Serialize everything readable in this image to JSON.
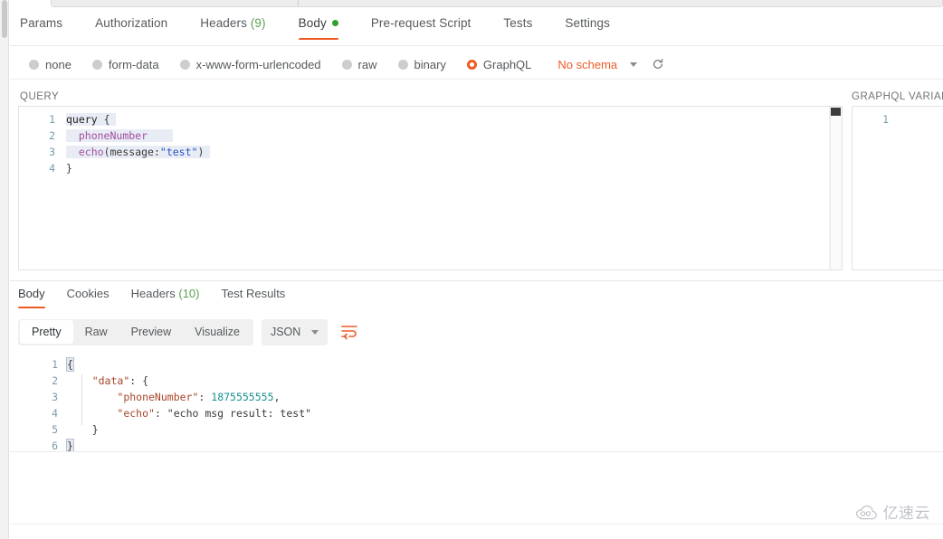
{
  "request_tabs": [
    {
      "label": "Params",
      "count": "",
      "active": false,
      "dot": false
    },
    {
      "label": "Authorization",
      "count": "",
      "active": false,
      "dot": false
    },
    {
      "label": "Headers",
      "count": "(9)",
      "active": false,
      "dot": false
    },
    {
      "label": "Body",
      "count": "",
      "active": true,
      "dot": true
    },
    {
      "label": "Pre-request Script",
      "count": "",
      "active": false,
      "dot": false
    },
    {
      "label": "Tests",
      "count": "",
      "active": false,
      "dot": false
    },
    {
      "label": "Settings",
      "count": "",
      "active": false,
      "dot": false
    }
  ],
  "body_types": [
    {
      "label": "none",
      "selected": false
    },
    {
      "label": "form-data",
      "selected": false
    },
    {
      "label": "x-www-form-urlencoded",
      "selected": false
    },
    {
      "label": "raw",
      "selected": false
    },
    {
      "label": "binary",
      "selected": false
    },
    {
      "label": "GraphQL",
      "selected": true
    }
  ],
  "schema": {
    "label": "No schema",
    "dropdown_icon": "chevron-down-icon",
    "refresh_icon": "refresh-icon",
    "accent_color": "#f05a28"
  },
  "query_panel": {
    "title": "QUERY",
    "line_numbers": [
      "1",
      "2",
      "3",
      "4"
    ],
    "lines": [
      {
        "text": "query {",
        "highlight": true
      },
      {
        "text": "  phoneNumber",
        "highlight": true
      },
      {
        "text": "  echo(message:\"test\")",
        "highlight": true
      },
      {
        "text": "}",
        "highlight": false
      }
    ],
    "code": "query {\n  phoneNumber\n  echo(message:\"test\")\n}"
  },
  "variables_panel": {
    "title": "GRAPHQL VARIABL",
    "line_numbers": [
      "1"
    ],
    "lines": [
      ""
    ]
  },
  "response_tabs": [
    {
      "label": "Body",
      "count": "",
      "active": true
    },
    {
      "label": "Cookies",
      "count": "",
      "active": false
    },
    {
      "label": "Headers",
      "count": "(10)",
      "active": false
    },
    {
      "label": "Test Results",
      "count": "",
      "active": false
    }
  ],
  "format_toolbar": {
    "buttons": [
      {
        "label": "Pretty",
        "active": true
      },
      {
        "label": "Raw",
        "active": false
      },
      {
        "label": "Preview",
        "active": false
      },
      {
        "label": "Visualize",
        "active": false
      }
    ],
    "select_value": "JSON",
    "select_icon": "chevron-down-icon",
    "wrap_icon": "wrap-lines-icon",
    "wrap_icon_color": "#ef5b25"
  },
  "response_body": {
    "line_numbers": [
      "1",
      "2",
      "3",
      "4",
      "5",
      "6"
    ],
    "raw": "{\n    \"data\": {\n        \"phoneNumber\": 1875555555,\n        \"echo\": \"echo msg result: test\"\n    }\n}",
    "lines": [
      {
        "n": "1",
        "text": "{"
      },
      {
        "n": "2",
        "text": "    \"data\": {"
      },
      {
        "n": "3",
        "text": "        \"phoneNumber\": 1875555555,"
      },
      {
        "n": "4",
        "text": "        \"echo\": \"echo msg result: test\""
      },
      {
        "n": "5",
        "text": "    }"
      },
      {
        "n": "6",
        "text": "}"
      }
    ],
    "values": {
      "data_key": "\"data\"",
      "phone_key": "\"phoneNumber\"",
      "phone_value": "1875555555",
      "echo_key": "\"echo\"",
      "echo_value": "\"echo msg result: test\""
    }
  },
  "watermark": {
    "text": "亿速云",
    "icon": "cloud-logo-icon"
  }
}
